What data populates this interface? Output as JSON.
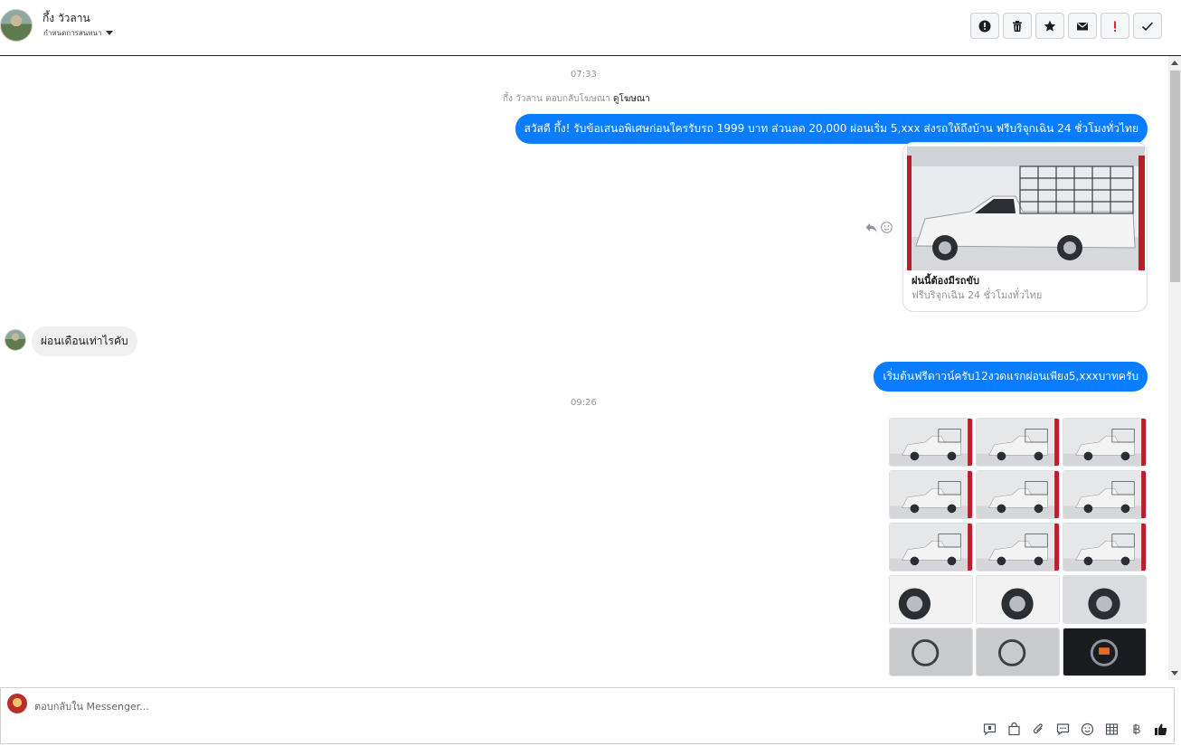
{
  "header": {
    "contact_name": "กึ้ง วัวลาน",
    "assign_label": "กำหนดการสนทนา",
    "actions": [
      {
        "name": "mark-spam-button",
        "icon": "alert-circle-icon"
      },
      {
        "name": "delete-button",
        "icon": "trash-icon"
      },
      {
        "name": "star-button",
        "icon": "star-icon"
      },
      {
        "name": "mark-unread-button",
        "icon": "envelope-icon"
      },
      {
        "name": "follow-up-button",
        "icon": "exclamation-icon"
      },
      {
        "name": "mark-done-button",
        "icon": "check-icon"
      }
    ]
  },
  "thread": {
    "time1": "07:33",
    "ad_reply_prefix": "กึ้ง วัวลาน ตอบกลับโฆษณา",
    "ad_reply_link": "ดูโฆษณา",
    "msg_out_1": "สวัสดี กึ้ง! รับข้อเสนอพิเศษก่อนใครรับรถ 1999 บาท ส่วนลด 20,000  ผ่อนเริ่ม 5,xxx ส่งรถให้ถึงบ้าน ฟรีบริจุกเฉิน 24 ชั่วโมงทั่วไทย",
    "card_title": "ฝนนี้ต้องมีรถขับ",
    "card_desc": "ฟรีบริจุกเฉิน 24 ชั่วโมงทั่วไทย",
    "msg_in_1": "ผ่อนเดือนเท่าไรคับ",
    "msg_out_2": "เริ่มต้นฟรีดาวน์ครับ12งวดแรกผ่อนเพียง5,xxxบาทครับ",
    "time2": "09:26",
    "photo_count": 15
  },
  "composer": {
    "placeholder": "ตอบกลับใน Messenger..."
  },
  "tools": [
    "chat-bubble-icon",
    "shopping-bag-icon",
    "paperclip-icon",
    "saved-replies-icon",
    "emoji-icon",
    "table-icon",
    "baht-icon",
    "thumbs-up-icon"
  ],
  "colors": {
    "outgoing_bubble": "#0a7cff",
    "incoming_bubble": "#f1f0f0",
    "accent_red": "#e4262c"
  }
}
